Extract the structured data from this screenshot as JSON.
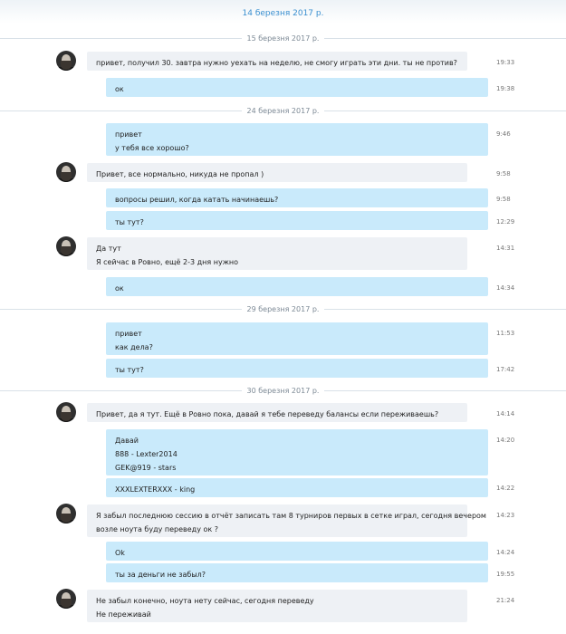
{
  "header": {
    "floating_date": "14 березня 2017 р."
  },
  "date_separators": [
    "15 березня 2017 р.",
    "24 березня 2017 р.",
    "29 березня 2017 р.",
    "30 березня 2017 р."
  ],
  "messages": [
    {
      "dir": "in",
      "lines": [
        "привет, получил 30. завтра нужно уехать на неделю, не смогу играть эти дни. ты не против?"
      ],
      "time": "19:33"
    },
    {
      "dir": "out",
      "lines": [
        "ок"
      ],
      "time": "19:38"
    },
    {
      "dir": "out",
      "lines": [
        "привет",
        "у тебя все хорошо?"
      ],
      "time": "9:46"
    },
    {
      "dir": "in",
      "lines": [
        "Привет, все нормально, никуда не пропал )"
      ],
      "time": "9:58"
    },
    {
      "dir": "out",
      "lines": [
        "вопросы решил, когда катать начинаешь?"
      ],
      "time": "9:58"
    },
    {
      "dir": "out",
      "lines": [
        "ты тут?"
      ],
      "time": "12:29"
    },
    {
      "dir": "in",
      "lines": [
        "Да тут",
        "Я сейчас в Ровно, ещё 2-3 дня нужно"
      ],
      "time": "14:31"
    },
    {
      "dir": "out",
      "lines": [
        "ок"
      ],
      "time": "14:34"
    },
    {
      "dir": "out",
      "lines": [
        "привет",
        "как дела?"
      ],
      "time": "11:53"
    },
    {
      "dir": "out",
      "lines": [
        "ты тут?"
      ],
      "time": "17:42"
    },
    {
      "dir": "in",
      "lines": [
        "Привет, да я тут. Ещё в Ровно пока, давай я тебе переведу балансы если переживаешь?"
      ],
      "time": "14:14"
    },
    {
      "dir": "out",
      "lines": [
        "Давай",
        "888 - Lexter2014",
        "GEK@919 - stars"
      ],
      "time": "14:20"
    },
    {
      "dir": "out",
      "lines": [
        "XXXLEXTERXXX - king"
      ],
      "time": "14:22"
    },
    {
      "dir": "in",
      "lines": [
        "Я забыл последнюю сессию в отчёт записать там 8 турниров первых в сетке играл, сегодня вечером",
        "возле ноута буду переведу ок ?"
      ],
      "time": "14:23"
    },
    {
      "dir": "out",
      "lines": [
        "Ok"
      ],
      "time": "14:24"
    },
    {
      "dir": "out",
      "lines": [
        "ты за деньги не забыл?"
      ],
      "time": "19:55"
    },
    {
      "dir": "in",
      "lines": [
        "Не забыл конечно, ноута нету сейчас, сегодня переведу",
        "Не переживай"
      ],
      "time": "21:24"
    }
  ]
}
